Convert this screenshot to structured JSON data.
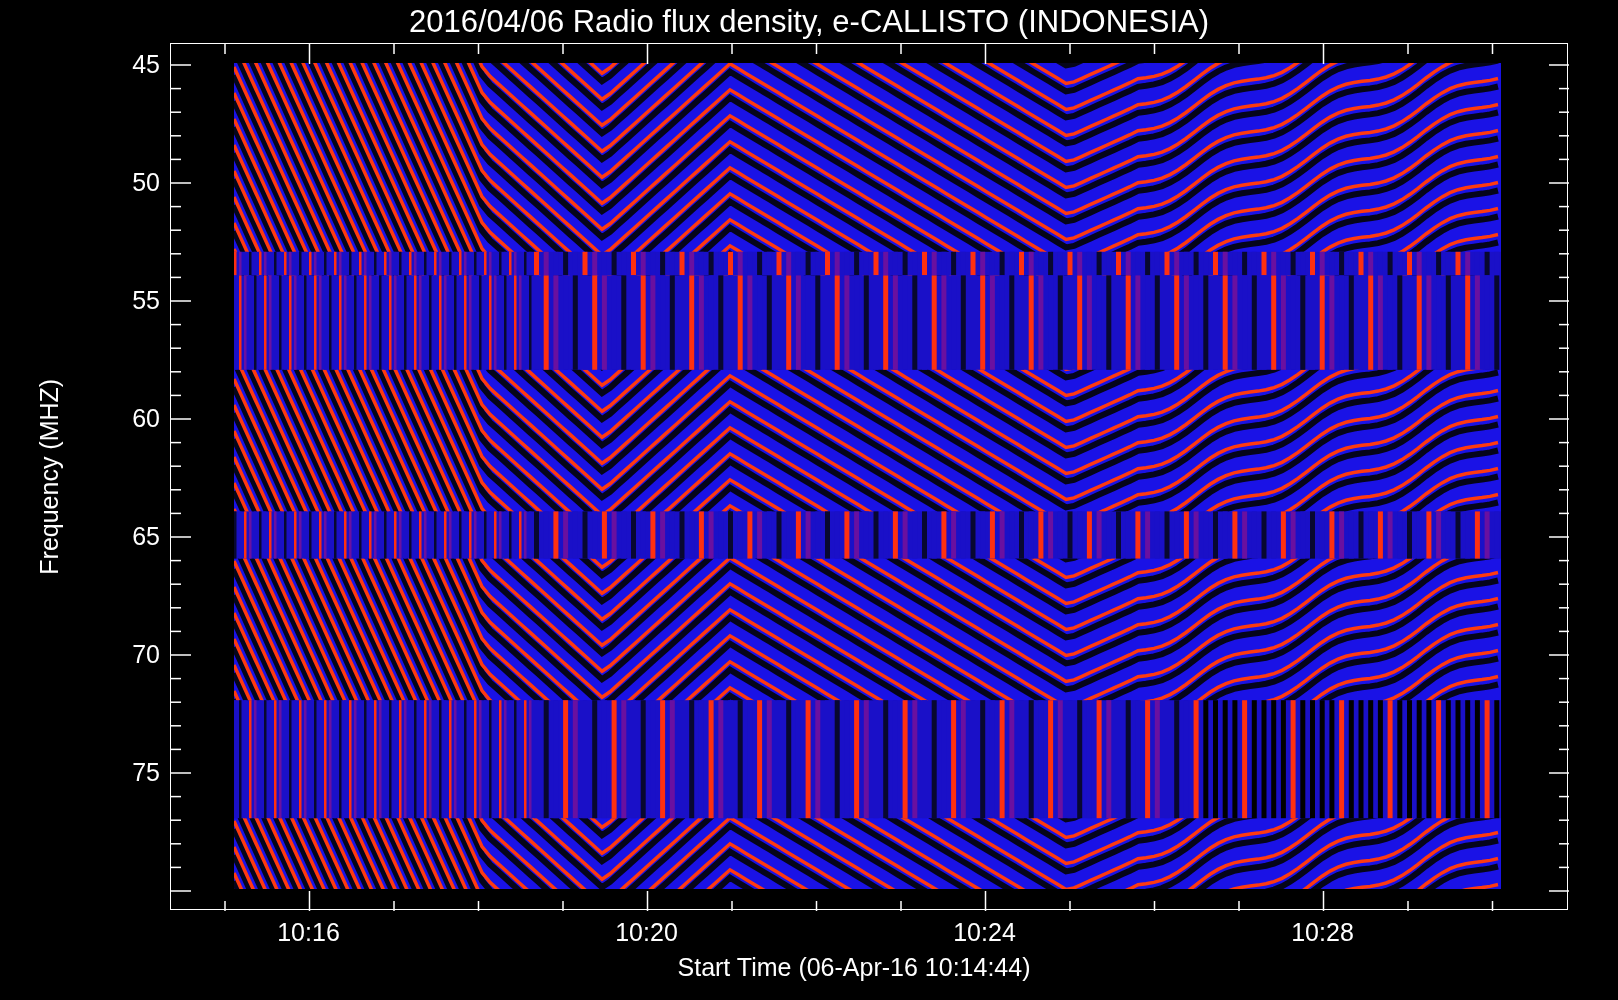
{
  "title": "2016/04/06  Radio flux density, e-CALLISTO (INDONESIA)",
  "y_axis": {
    "label": "Frequency (MHZ)",
    "ticks": [
      "45",
      "50",
      "55",
      "60",
      "65",
      "70",
      "75"
    ]
  },
  "x_axis": {
    "label": "Start Time (06-Apr-16 10:14:44)",
    "ticks": [
      "10:16",
      "10:20",
      "10:24",
      "10:28"
    ]
  }
}
